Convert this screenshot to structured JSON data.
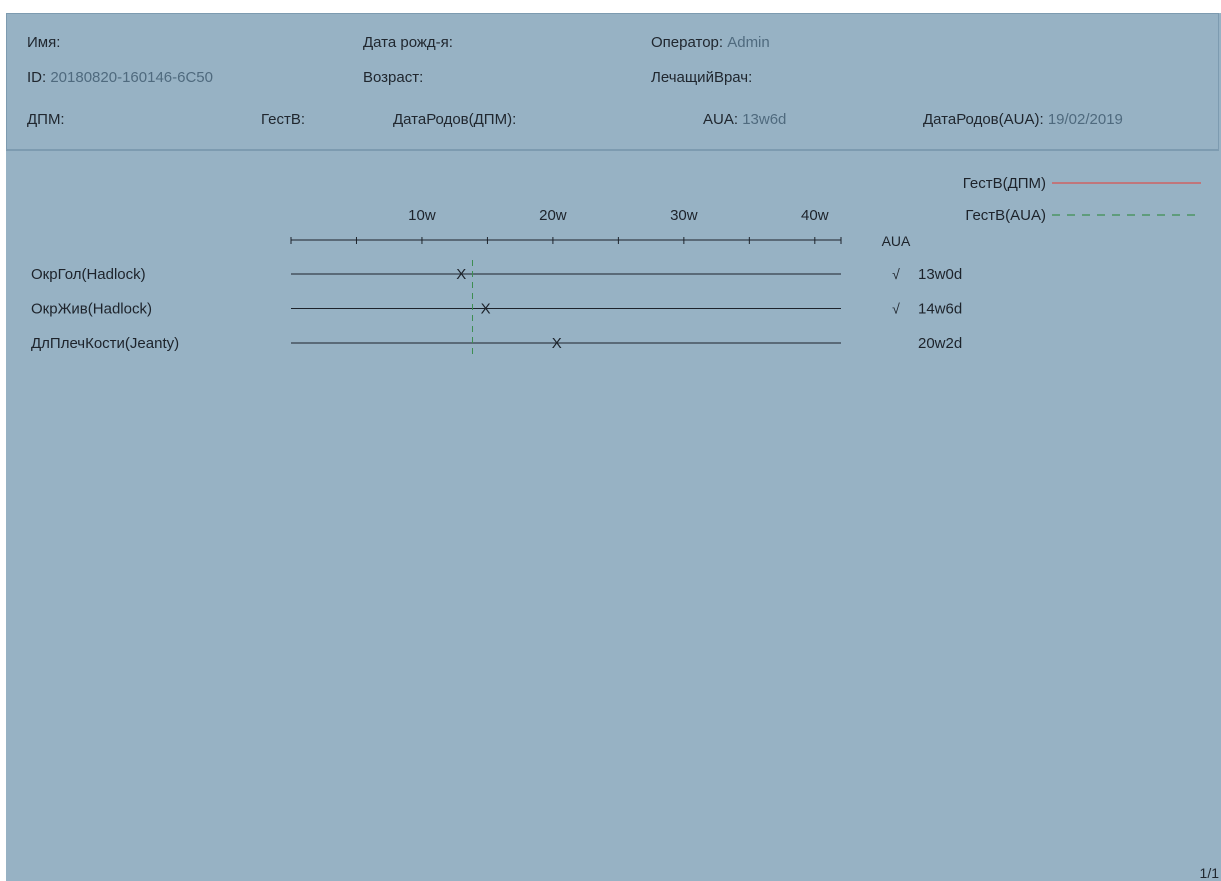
{
  "patient": {
    "name_label": "Имя:",
    "name_value": "",
    "dob_label": "Дата рожд-я:",
    "dob_value": "",
    "operator_label": "Оператор: ",
    "operator_value": "Admin",
    "id_label": "ID: ",
    "id_value": "20180820-160146-6C50",
    "age_label": "Возраст:",
    "age_value": "",
    "doctor_label": "ЛечащийВрач:",
    "doctor_value": "",
    "lmp_label": "ДПМ:",
    "lmp_value": "",
    "ga_label": "ГестВ:",
    "ga_value": "",
    "edd_lmp_label": "ДатаРодов(ДПМ):",
    "edd_lmp_value": "",
    "aua_label": "AUA: ",
    "aua_value": "13w6d",
    "edd_aua_label": "ДатаРодов(AUA): ",
    "edd_aua_value": "19/02/2019"
  },
  "legend": [
    {
      "label": "ГестВ(ДПМ)",
      "color": "#d9534f",
      "style": "solid"
    },
    {
      "label": "ГестВ(AUA)",
      "color": "#3e8e52",
      "style": "dashed"
    }
  ],
  "aua_column_header": "AUA",
  "page_number": "1/1",
  "colors": {
    "background": "#97b2c4",
    "axis": "#1d232b",
    "aua_line": "#3e8e52",
    "lmp_line": "#d9534f"
  },
  "chart_data": {
    "type": "scatter",
    "x_unit": "weeks",
    "xlim": [
      0,
      42
    ],
    "tick_labels": [
      "10w",
      "20w",
      "30w",
      "40w"
    ],
    "tick_values": [
      10,
      20,
      30,
      40
    ],
    "aua_marker_weeks": 13.86,
    "rows": [
      {
        "label": "ОкрГол(Hadlock)",
        "value_weeks": 13.0,
        "mark": "X",
        "checked": true,
        "check_symbol": "√",
        "ga_text": "13w0d"
      },
      {
        "label": "ОкрЖив(Hadlock)",
        "value_weeks": 14.86,
        "mark": "X",
        "checked": true,
        "check_symbol": "√",
        "ga_text": "14w6d"
      },
      {
        "label": "ДлПлечКости(Jeanty)",
        "value_weeks": 20.29,
        "mark": "X",
        "checked": false,
        "check_symbol": "",
        "ga_text": "20w2d"
      }
    ]
  }
}
